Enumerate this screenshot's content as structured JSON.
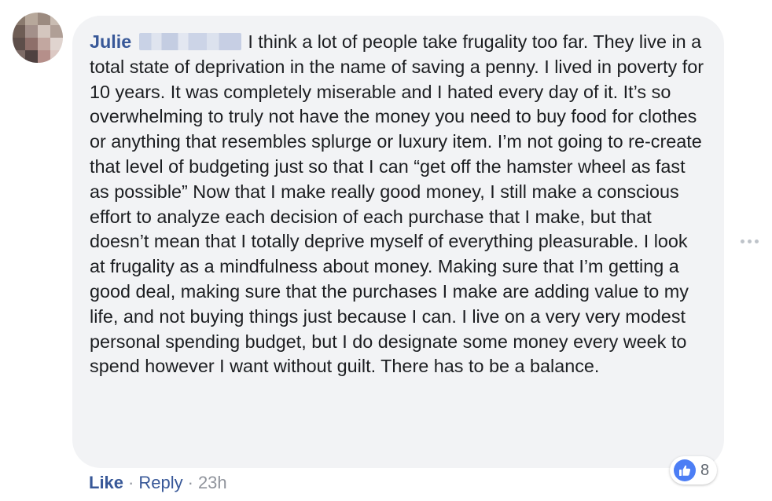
{
  "comment": {
    "author": "Julie",
    "body": "I think a lot of people take frugality too far. They live in a total state of deprivation in the name of saving a penny. I lived in poverty for 10 years. It was completely miserable and I hated every day of it. It’s so overwhelming to truly not have the money you need to buy food for clothes or anything that resembles splurge or luxury item. I’m not going to re-create that level of budgeting just so that I can “get off the hamster wheel as fast as possible” Now that I make really good money, I still make a conscious effort to analyze each decision of each purchase that I make, but that doesn’t mean that I totally deprive myself of everything pleasurable. I look at frugality as a mindfulness about money. Making sure that I’m getting a good deal, making sure that the purchases I make are adding value to my life, and not buying things just because I can. I live on a very very modest personal spending budget, but I do designate some money every week to spend however I want without guilt. There has to be a balance.",
    "reaction_icon": "like-icon",
    "reaction_count": "8",
    "actions": {
      "like_label": "Like",
      "separator": "·",
      "reply_label": "Reply",
      "timestamp": "23h"
    },
    "more_icon": "more-options-icon"
  },
  "colors": {
    "name_link": "#385898",
    "bubble_bg": "#f2f3f5",
    "body_text": "#1c1e21",
    "meta_text": "#90949c",
    "like_blue": "#4c7ef5"
  }
}
